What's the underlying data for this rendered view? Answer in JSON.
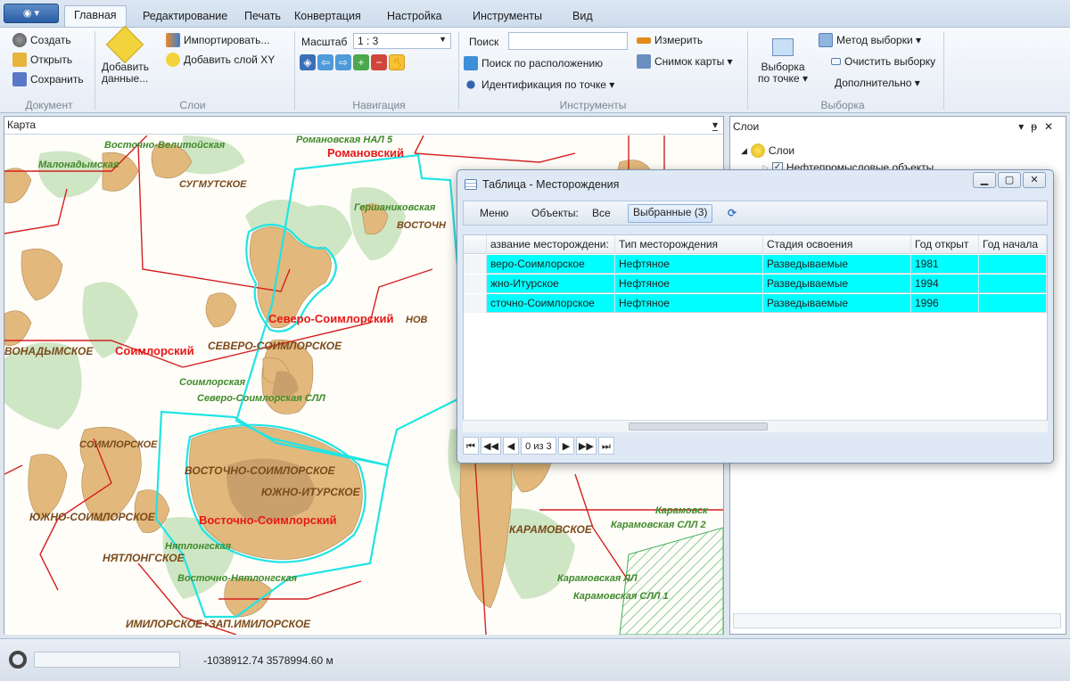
{
  "tabs": [
    "Главная",
    "Редактирование",
    "Печать",
    "Конвертация",
    "Настройка",
    "Инструменты",
    "Вид"
  ],
  "ribbon": {
    "document": {
      "create": "Создать",
      "open": "Открыть",
      "save": "Сохранить",
      "label": "Документ"
    },
    "layers": {
      "add_data_line1": "Добавить",
      "add_data_line2": "данные...",
      "import": "Импортировать...",
      "add_xy": "Добавить слой XY",
      "label": "Слои"
    },
    "navigation": {
      "scale_label": "Масштаб",
      "scale_value": "1 : 3",
      "label": "Навигация"
    },
    "tools": {
      "search_label": "Поиск",
      "search_placeholder": "",
      "search_location": "Поиск по расположению",
      "identify": "Идентификация по точке ▾",
      "measure": "Измерить",
      "snapshot": "Снимок карты ▾",
      "label": "Инструменты"
    },
    "selection": {
      "by_point_line1": "Выборка",
      "by_point_line2": "по точке ▾",
      "method": "Метод выборки ▾",
      "clear": "Очистить выборку",
      "more": "Дополнительно ▾",
      "label": "Выборка"
    }
  },
  "map": {
    "title": "Карта",
    "labels": {
      "vostochno_velitoiskaya": "Восточно-Велитойская",
      "romanovskaya_nal5": "Романовская НАЛ 5",
      "romanovsky": "Романовский",
      "malonadymskaya": "Малонадымская",
      "surgutskoe": "СУГМУТСКОЕ",
      "gershanikovskaya": "Гершаниковская",
      "vostochn_cut": "ВОСТОЧН",
      "severo_soimlorsky": "Северо-Соимлорский",
      "nov_cut": "НОВ",
      "vonadymskoe": "ВОНАДЫМСКОЕ",
      "soimlorsky": "Соимлорский",
      "severo_soimlorskoe": "СЕВЕРО-СОИМЛОРСКОЕ",
      "soimlorskaya": "Соимлорская",
      "severo_soimlorskaya_sll": "Северо-Соимлорская СЛЛ",
      "soimlorskoe": "СОИМЛОРСКОЕ",
      "vostochno_soimlorskoe": "ВОСТОЧНО-СОИМЛОРСКОЕ",
      "yuzhno_iturskoe": "ЮЖНО-ИТУРСКОЕ",
      "yuzhno_soimlorskoe": "ЮЖНО-СОИМЛОРСКОЕ",
      "vostochno_soimlorsky": "Восточно-Соимлорский",
      "nyatlongskaya": "Нятлонгская",
      "nyatlongskoe": "НЯТЛОНГСКОЕ",
      "vostochno_nyatlongskaya": "Восточно-Нятлонгская",
      "imilorskoe": "ИМИЛОРСКОЕ+ЗАП.ИМИЛОРСКОЕ",
      "karamovskoe": "КАРАМОВСКОЕ",
      "karamovskaya_sll2": "Карамовская СЛЛ 2",
      "karamovsk": "Карамовск",
      "karamovskaya_ll": "Карамовская ЛЛ",
      "karamovskaya_sll1": "Карамовская СЛЛ 1"
    }
  },
  "layers_panel": {
    "title": "Слои",
    "root": "Слои",
    "item1": "Нефтепромысловые объекты"
  },
  "table_window": {
    "title": "Таблица - Месторождения",
    "menu": "Меню",
    "objects_label": "Объекты:",
    "all": "Все",
    "selected": "Выбранные (3)",
    "columns": [
      "азвание месторождени:",
      "Тип месторождения",
      "Стадия освоения",
      "Год открыт",
      "Год начала"
    ],
    "rows": [
      [
        "веро-Соимлорское",
        "Нефтяное",
        "Разведываемые",
        "1981",
        ""
      ],
      [
        "жно-Итурское",
        "Нефтяное",
        "Разведываемые",
        "1994",
        ""
      ],
      [
        "сточно-Соимлорское",
        "Нефтяное",
        "Разведываемые",
        "1996",
        ""
      ]
    ],
    "nav_text": "0 из 3"
  },
  "status": {
    "coords": "-1038912.74  3578994.60 м"
  }
}
